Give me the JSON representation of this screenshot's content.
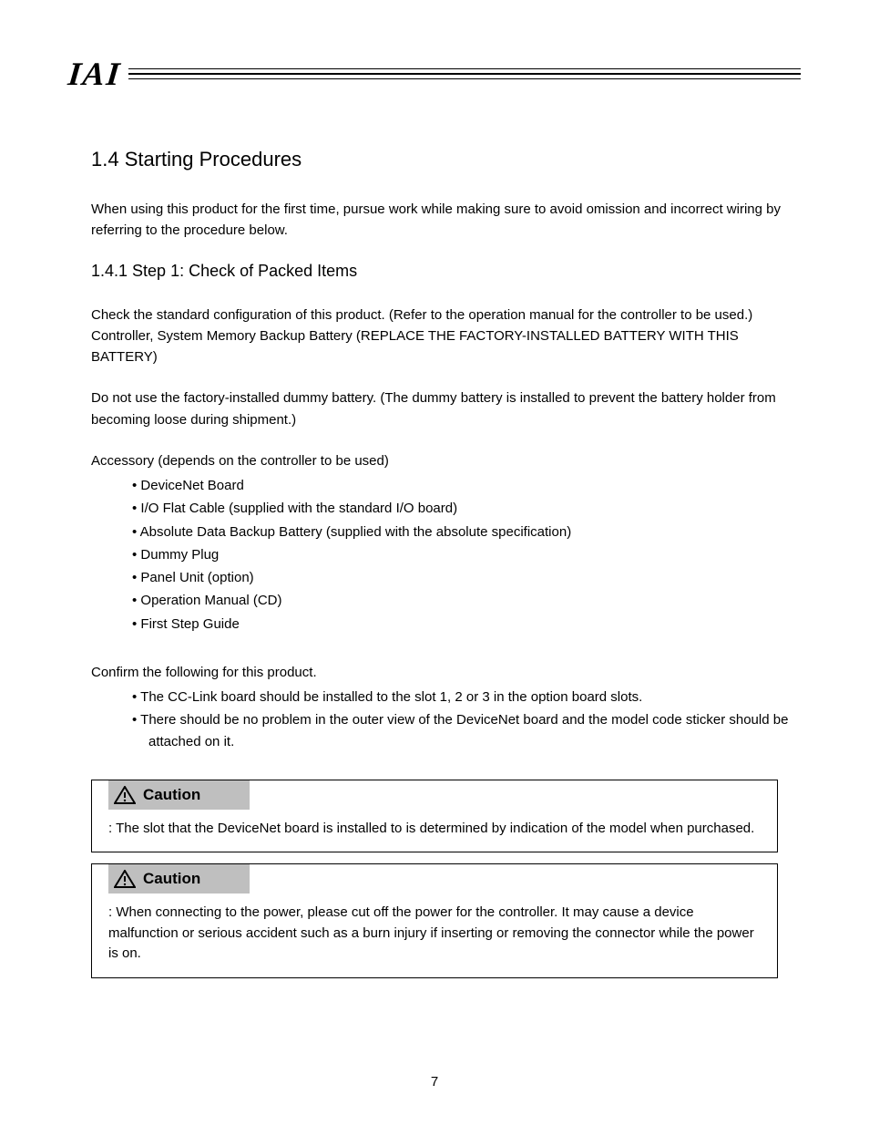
{
  "logo": "IAI",
  "section": {
    "title": "1.4    Starting Procedures",
    "intro": "When using this product for the first time, pursue work while making sure to avoid omission and incorrect wiring by referring to the procedure below."
  },
  "proc": {
    "title": "1.4.1    Step 1: Check of Packed Items",
    "lead": "Check the standard configuration of this product. (Refer to the operation manual for the controller to be used.)\nController, System Memory Backup Battery (REPLACE THE FACTORY-INSTALLED BATTERY WITH THIS BATTERY)",
    "caution": "Do not use the factory-installed dummy battery. (The dummy battery is installed to prevent the battery holder from becoming loose during shipment.)",
    "accessory_lead": "Accessory (depends on the controller to be used)",
    "accessories": [
      "DeviceNet Board",
      "I/O Flat Cable (supplied with the standard I/O board)",
      "Absolute Data Backup Battery (supplied with the absolute specification)",
      "Dummy Plug",
      "Panel Unit (option)",
      "Operation Manual (CD)",
      "First Step Guide"
    ],
    "confirm_lead": "Confirm the following for this product.",
    "confirms": [
      "The CC-Link board should be installed to the slot 1, 2 or 3 in the option board slots.",
      "There should be no problem in the outer view of the DeviceNet board and the model code sticker should be attached on it."
    ]
  },
  "callouts": {
    "c1": {
      "label": "Caution",
      "text": ": The slot that the DeviceNet board is installed to is determined by indication of the model when purchased."
    },
    "c2": {
      "label": "Caution",
      "text": ": When connecting to the power, please cut off the power for the controller. It may cause a device malfunction or serious accident such as a burn injury if inserting or removing the connector while the power is on."
    }
  },
  "page": "7"
}
